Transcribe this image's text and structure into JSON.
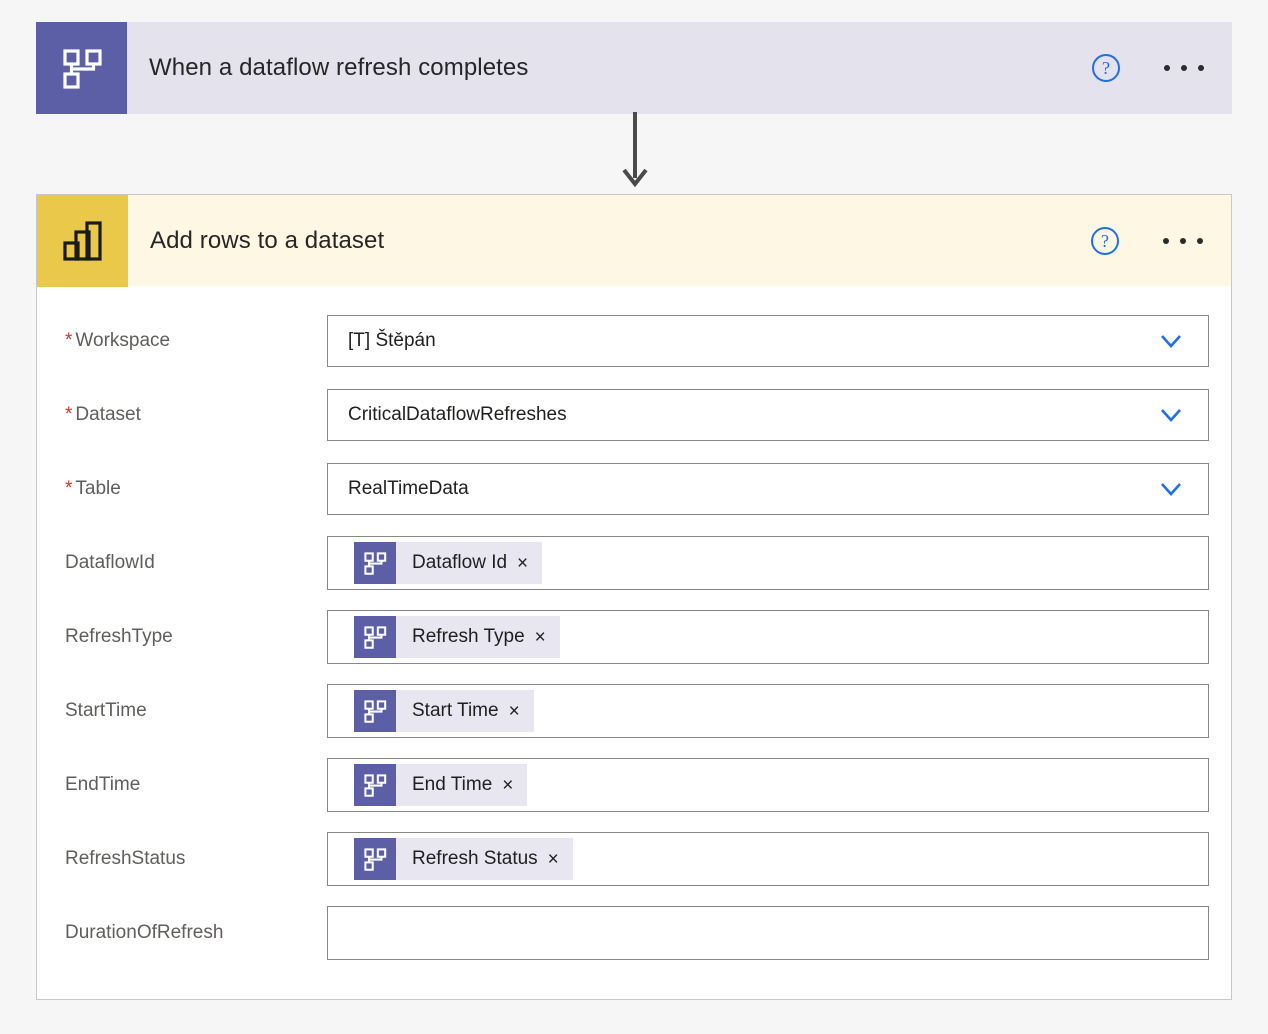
{
  "colors": {
    "trigger_header_bg": "#e3e2ed",
    "action_header_bg": "#fdf7e4",
    "dataflow_icon_bg": "#5c5fa6",
    "powerbi_icon_bg": "#e9c84a",
    "accent_blue": "#1f6feb",
    "required_red": "#d6331f",
    "page_bg": "#f6f6f6"
  },
  "trigger_card": {
    "title": "When a dataflow refresh completes",
    "icon": "dataflow-icon",
    "help_label": "?",
    "more_label": "…"
  },
  "action_card": {
    "title": "Add rows to a dataset",
    "icon": "powerbi-bar-chart-icon",
    "help_label": "?",
    "more_label": "…",
    "fields": [
      {
        "label": "Workspace",
        "required": true,
        "type": "dropdown",
        "value": "[T] Štěpán"
      },
      {
        "label": "Dataset",
        "required": true,
        "type": "dropdown",
        "value": "CriticalDataflowRefreshes"
      },
      {
        "label": "Table",
        "required": true,
        "type": "dropdown",
        "value": "RealTimeData"
      },
      {
        "label": "DataflowId",
        "required": false,
        "type": "token",
        "token": "Dataflow Id",
        "remove_label": "×"
      },
      {
        "label": "RefreshType",
        "required": false,
        "type": "token",
        "token": "Refresh Type",
        "remove_label": "×"
      },
      {
        "label": "StartTime",
        "required": false,
        "type": "token",
        "token": "Start Time",
        "remove_label": "×"
      },
      {
        "label": "EndTime",
        "required": false,
        "type": "token",
        "token": "End Time",
        "remove_label": "×"
      },
      {
        "label": "RefreshStatus",
        "required": false,
        "type": "token",
        "token": "Refresh Status",
        "remove_label": "×"
      },
      {
        "label": "DurationOfRefresh",
        "required": false,
        "type": "empty",
        "value": ""
      }
    ]
  }
}
